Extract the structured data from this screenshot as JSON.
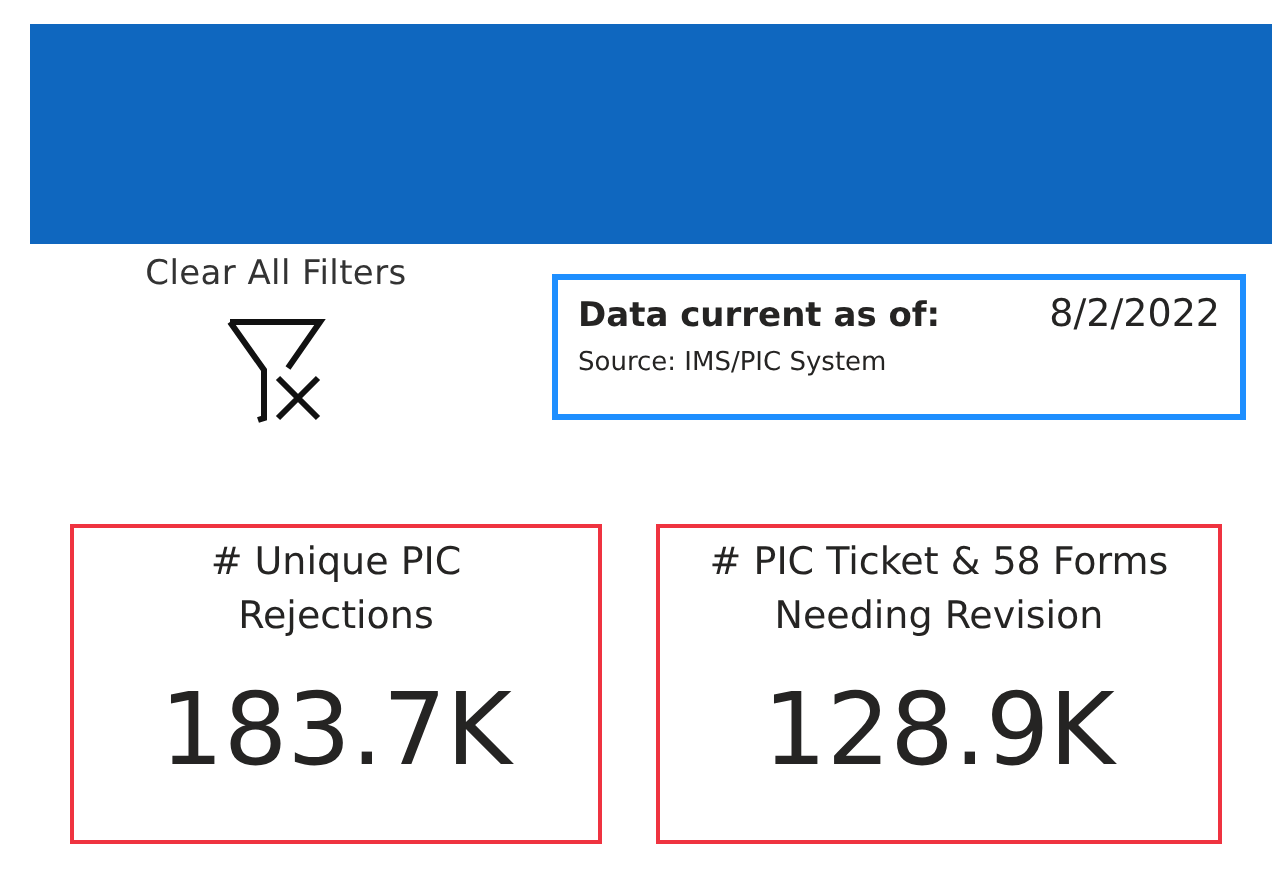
{
  "clear_filters": {
    "label": "Clear All Filters"
  },
  "data_status": {
    "label": "Data current as of:",
    "date": "8/2/2022",
    "source": "Source: IMS/PIC System"
  },
  "cards": [
    {
      "title": "# Unique PIC Rejections",
      "value": "183.7K"
    },
    {
      "title": "# PIC Ticket & 58 Forms Needing Revision",
      "value": "128.9K"
    }
  ]
}
